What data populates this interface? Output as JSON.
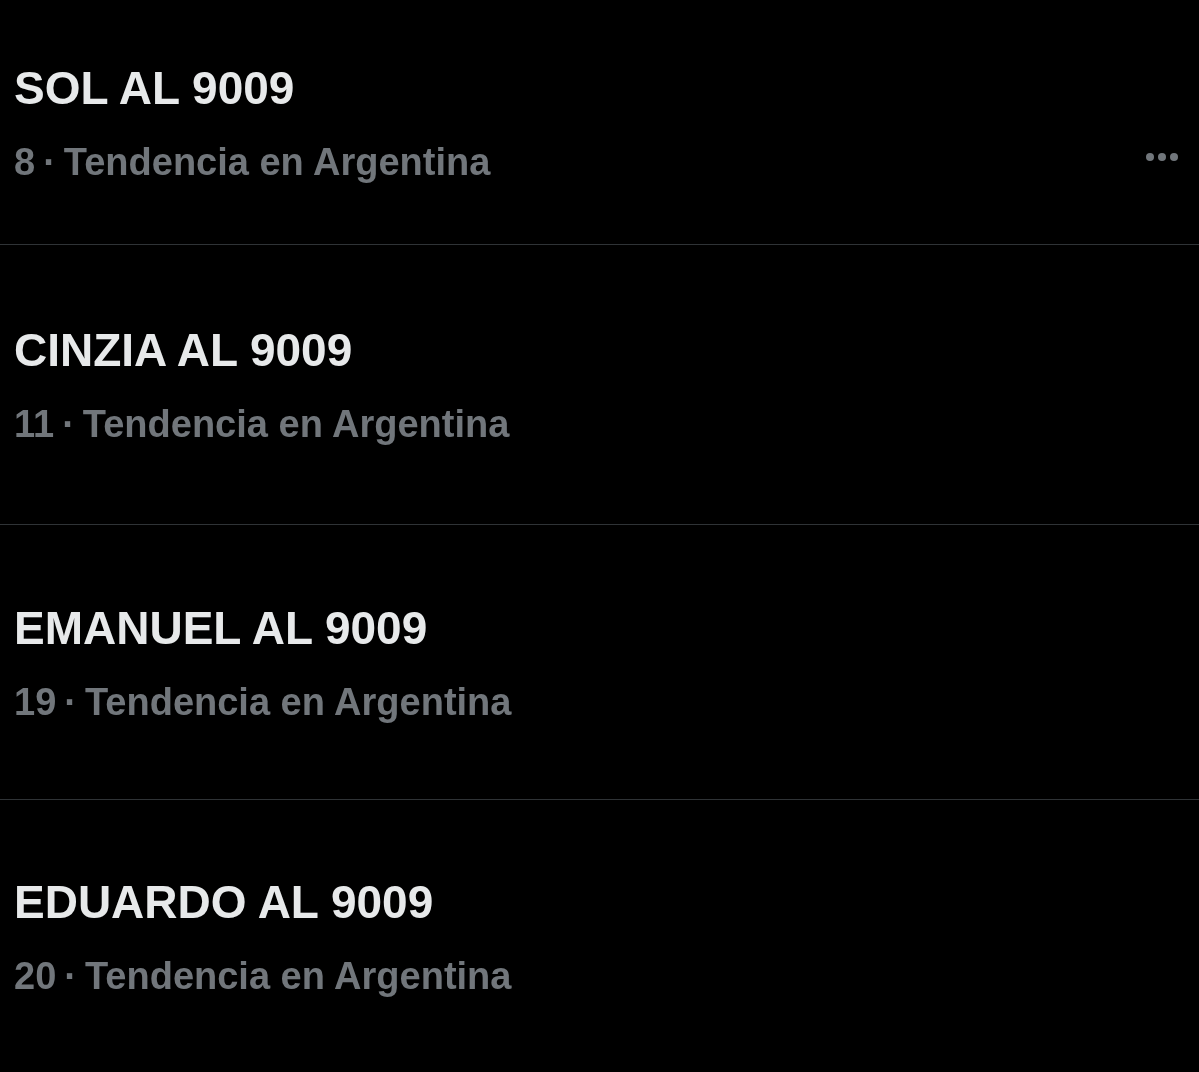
{
  "trends": [
    {
      "title": "SOL AL 9009",
      "rank": "8",
      "separator": "·",
      "context": "Tendencia en Argentina",
      "more_menu": true
    },
    {
      "title": "CINZIA AL 9009",
      "rank": "11",
      "separator": "·",
      "context": "Tendencia en Argentina",
      "more_menu": false
    },
    {
      "title": "EMANUEL AL 9009",
      "rank": "19",
      "separator": "·",
      "context": "Tendencia en Argentina",
      "more_menu": false
    },
    {
      "title": "EDUARDO AL 9009",
      "rank": "20",
      "separator": "·",
      "context": "Tendencia en Argentina",
      "more_menu": false
    }
  ]
}
